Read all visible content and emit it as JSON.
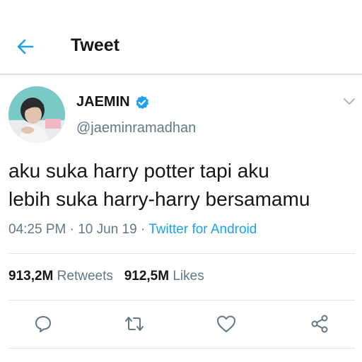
{
  "header": {
    "title": "Tweet"
  },
  "tweet": {
    "display_name": "JAEMIN",
    "handle": "@jaeminramadhan",
    "text_line1": "aku suka harry potter tapi aku",
    "text_line2": "lebih suka harry-harry bersamamu",
    "time": "04:25 PM",
    "date": "10 Jun 19",
    "source": "Twitter for Android",
    "retweets_count": "913,2M",
    "retweets_label": "Retweets",
    "likes_count": "912,5M",
    "likes_label": "Likes"
  },
  "colors": {
    "accent": "#1da1f2",
    "secondary_text": "#657786",
    "divider": "#e1e4e6"
  },
  "icons": [
    "back-arrow-icon",
    "verified-badge-icon",
    "chevron-down-icon",
    "reply-icon",
    "retweet-icon",
    "like-icon",
    "share-icon"
  ]
}
